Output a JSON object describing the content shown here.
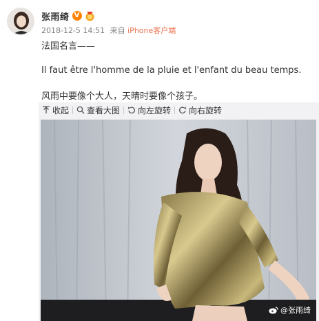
{
  "post": {
    "author": "张雨绮",
    "time": "2018-12-5 14:51",
    "from_label": "来自",
    "device": "iPhone客户端",
    "lines": [
      "法国名言——",
      "Il faut être l'homme de la pluie et l'enfant du beau temps.",
      "风雨中要像个大人，天晴时要像个孩子。"
    ]
  },
  "media_toolbar": {
    "collapse_label": "收起",
    "view_large_label": "查看大图",
    "rotate_left_label": "向左旋转",
    "rotate_right_label": "向右旋转"
  },
  "photo": {
    "watermark": "@张雨绮"
  },
  "icons": {
    "verified": "verified-v-badge-icon",
    "medal": "medal-badge-icon",
    "collapse": "arrow-up-icon",
    "view_large": "magnifier-icon",
    "rotate_left": "rotate-left-icon",
    "rotate_right": "rotate-right-icon",
    "weibo": "weibo-logo-icon"
  },
  "colors": {
    "accent_orange": "#ff8200",
    "link": "#eb7350",
    "meta_gray": "#808080",
    "toolbar_bg": "#f2f2f5"
  }
}
